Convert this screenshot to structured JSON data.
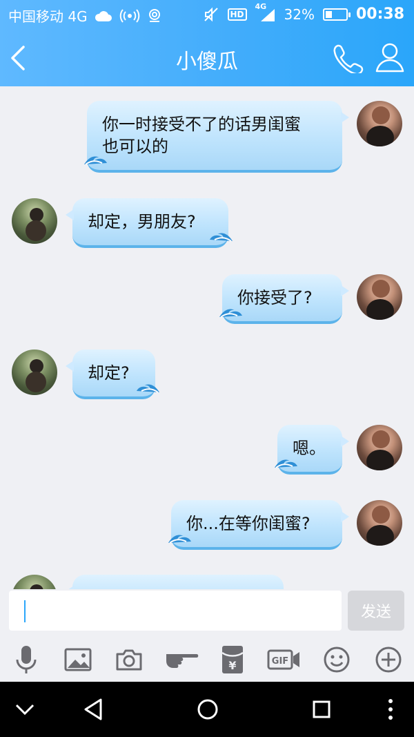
{
  "status_bar": {
    "carrier": "中国移动 4G",
    "network_small": "4G",
    "hd_label": "HD",
    "battery_percent": "32%",
    "battery_level": 0.32,
    "time": "00:38"
  },
  "nav": {
    "title": "小傻瓜"
  },
  "messages": [
    {
      "sender": "self",
      "text": "你一时接受不了的话男闺蜜\n也可以的"
    },
    {
      "sender": "friend",
      "text": "却定，男朋友?"
    },
    {
      "sender": "self",
      "text": "你接受了?"
    },
    {
      "sender": "friend",
      "text": "却定?"
    },
    {
      "sender": "self",
      "text": "嗯。"
    },
    {
      "sender": "self",
      "text": "你...在等你闺蜜?"
    }
  ],
  "input": {
    "value": "",
    "send_label": "发送"
  },
  "toolbar": {
    "gif_label": "GIF",
    "yuan_label": "¥",
    "icons": [
      "microphone-icon",
      "image-icon",
      "camera-icon",
      "poke-hand-icon",
      "red-packet-icon",
      "gif-icon",
      "emoji-icon",
      "plus-icon"
    ]
  },
  "colors": {
    "header_start": "#5fb9ff",
    "header_end": "#2aa6fa",
    "bubble_light": "#dff2ff",
    "bubble_dark": "#a9d8f8",
    "background": "#eff0f4",
    "icon_gray": "#6b6b70",
    "send_disabled": "#d6d7db"
  }
}
